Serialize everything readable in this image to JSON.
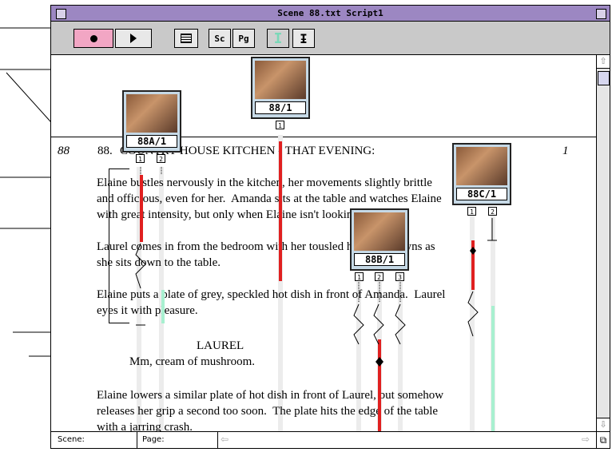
{
  "window": {
    "title": "Scene 88.txt Script1"
  },
  "toolbar": {
    "record_icon": "record-icon",
    "play_icon": "play-icon",
    "list_icon": "list-icon",
    "sc_label": "Sc",
    "pg_label": "Pg",
    "text_cursor_icon": "text-cursor-icon",
    "split_cursor_icon": "split-cursor-icon"
  },
  "script": {
    "scene_number_italic": "88",
    "scene_number": "88.",
    "slugline": "COUNTRY HOUSE KITCHEN - THAT EVENING:",
    "page_marker": "1",
    "lines": [
      "Elaine bustles nervously in the kitchen, her movements slightly brittle",
      "and officious, even for her.  Amanda sits at the table and watches Elaine",
      "with great intensity, but only when Elaine isn't looking.",
      "Laurel comes in from the bedroom with her tousled hair. She yawns as",
      "she sits down to the table.",
      "Elaine puts a plate of grey, speckled hot dish in front of Amanda.  Laurel",
      "eyes it with pleasure."
    ],
    "character": "LAUREL",
    "dialogue": "Mm, cream of mushroom.",
    "lines2": [
      "Elaine lowers a similar plate of hot dish in front of Laurel, but somehow",
      "releases her grip a second too soon.  The plate hits the edge of the table",
      "with a jarring crash."
    ]
  },
  "takes": [
    {
      "label": "88/1",
      "takes": [
        "1"
      ]
    },
    {
      "label": "88A/1",
      "takes": [
        "1",
        "2"
      ]
    },
    {
      "label": "88C/1",
      "takes": [
        "1",
        "2"
      ]
    },
    {
      "label": "88B/1",
      "takes": [
        "1",
        "2",
        "3"
      ]
    }
  ],
  "status": {
    "scene_label": "Scene:",
    "page_label": "Page:"
  },
  "colors": {
    "title_bar": "#9c87c2",
    "record_button": "#f2a6c4",
    "take_red": "#e02020",
    "take_mint": "#a8f0d0"
  }
}
